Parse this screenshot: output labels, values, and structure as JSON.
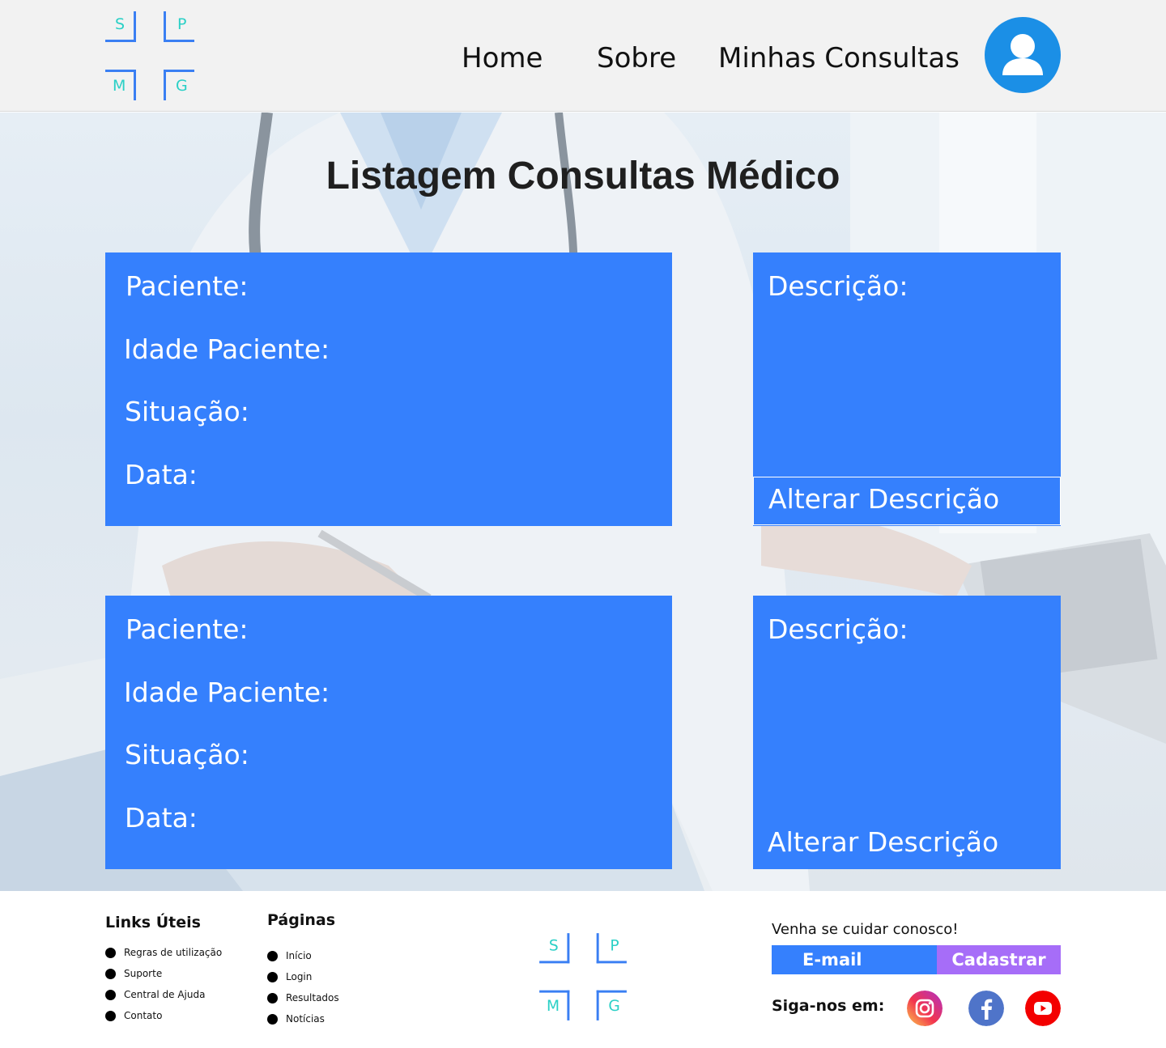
{
  "logo": {
    "letters": [
      "S",
      "P",
      "M",
      "G"
    ]
  },
  "nav": {
    "home": "Home",
    "about": "Sobre",
    "appointments": "Minhas Consultas"
  },
  "page": {
    "title": "Listagem Consultas Médico"
  },
  "consultations": [
    {
      "patient_label": "Paciente:",
      "age_label": "Idade Paciente:",
      "status_label": "Situação:",
      "date_label": "Data:",
      "description_label": "Descrição:",
      "edit_description_label": "Alterar Descrição"
    },
    {
      "patient_label": "Paciente:",
      "age_label": "Idade Paciente:",
      "status_label": "Situação:",
      "date_label": "Data:",
      "description_label": "Descrição:",
      "edit_description_label": "Alterar Descrição"
    }
  ],
  "footer": {
    "useful_links": {
      "title": "Links Úteis",
      "items": [
        "Regras de utilização",
        "Suporte",
        "Central de Ajuda",
        "Contato"
      ]
    },
    "pages": {
      "title": "Páginas",
      "items": [
        "Início",
        "Login",
        "Resultados",
        "Notícias"
      ]
    },
    "newsletter": {
      "title": "Venha se cuidar conosco!",
      "email_placeholder": "E-mail",
      "signup_label": "Cadastrar"
    },
    "follow_label": "Siga-nos em:",
    "social_icons": [
      "instagram-icon",
      "facebook-icon",
      "youtube-icon"
    ]
  },
  "colors": {
    "card_blue": "#3580fd",
    "avatar_blue": "#1b8fe6",
    "logo_letters": "#2ad0c6",
    "signup_purple": "#a66df8",
    "header_bg": "#f2f2f2"
  }
}
